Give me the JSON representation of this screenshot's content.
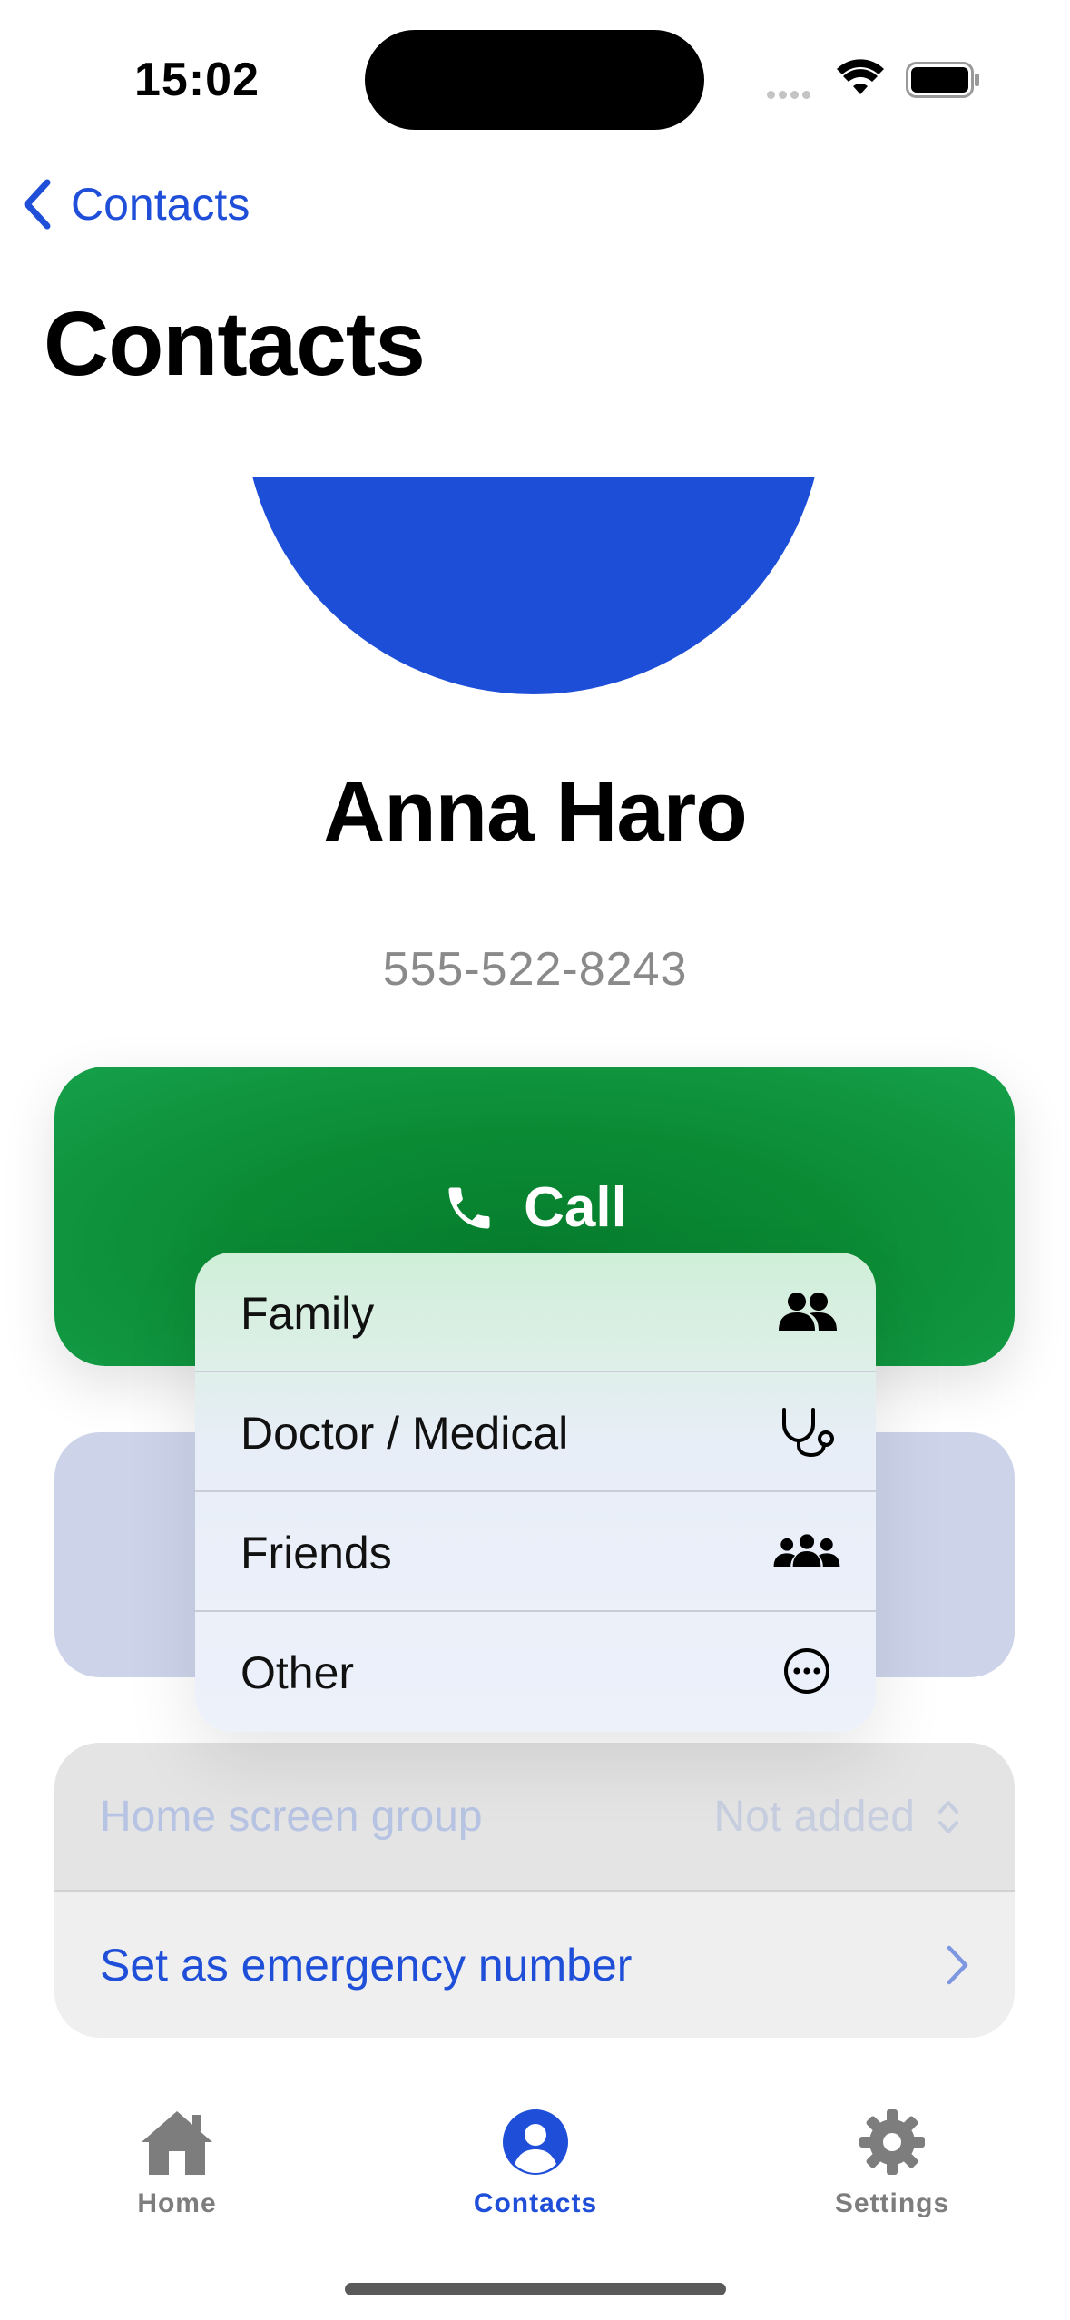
{
  "status_bar": {
    "time": "15:02"
  },
  "nav": {
    "back_label": "Contacts",
    "title": "Contacts"
  },
  "contact": {
    "name": "Anna Haro",
    "phone": "555-522-8243",
    "avatar_color": "#1d4ed8"
  },
  "actions": {
    "call_label": "Call",
    "call_color": "#0b8a34"
  },
  "settings": {
    "home_group_label": "Home screen group",
    "home_group_value": "Not added",
    "emergency_label": "Set as emergency number"
  },
  "group_menu": {
    "items": [
      {
        "label": "Family",
        "icon": "family-icon"
      },
      {
        "label": "Doctor / Medical",
        "icon": "stethoscope-icon"
      },
      {
        "label": "Friends",
        "icon": "friends-icon"
      },
      {
        "label": "Other",
        "icon": "ellipsis-circle-icon"
      }
    ]
  },
  "tab_bar": {
    "active_color": "#1f4fd8",
    "tabs": [
      {
        "label": "Home",
        "icon": "house-icon"
      },
      {
        "label": "Contacts",
        "icon": "person-circle-icon",
        "selected": true
      },
      {
        "label": "Settings",
        "icon": "gear-icon"
      }
    ]
  }
}
